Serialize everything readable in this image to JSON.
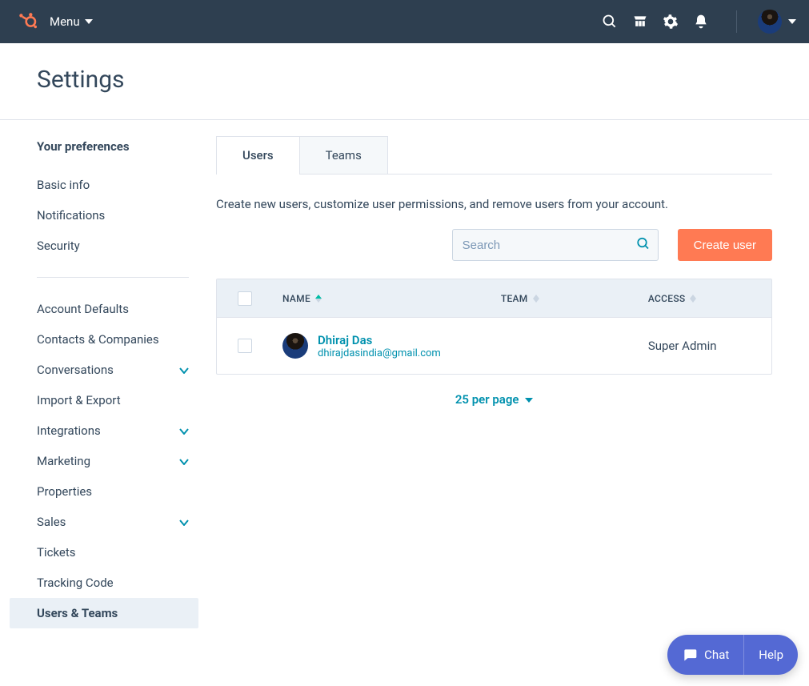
{
  "topnav": {
    "menu_label": "Menu"
  },
  "page": {
    "title": "Settings"
  },
  "sidebar": {
    "section_title": "Your preferences",
    "items_a": [
      {
        "label": "Basic info"
      },
      {
        "label": "Notifications"
      },
      {
        "label": "Security"
      }
    ],
    "items_b": [
      {
        "label": "Account Defaults",
        "expandable": false
      },
      {
        "label": "Contacts & Companies",
        "expandable": false
      },
      {
        "label": "Conversations",
        "expandable": true
      },
      {
        "label": "Import & Export",
        "expandable": false
      },
      {
        "label": "Integrations",
        "expandable": true
      },
      {
        "label": "Marketing",
        "expandable": true
      },
      {
        "label": "Properties",
        "expandable": false
      },
      {
        "label": "Sales",
        "expandable": true
      },
      {
        "label": "Tickets",
        "expandable": false
      },
      {
        "label": "Tracking Code",
        "expandable": false
      },
      {
        "label": "Users & Teams",
        "expandable": false,
        "active": true
      }
    ]
  },
  "tabs": [
    {
      "label": "Users",
      "active": true
    },
    {
      "label": "Teams",
      "active": false
    }
  ],
  "subtext": "Create new users, customize user permissions, and remove users from your account.",
  "toolbar": {
    "search_placeholder": "Search",
    "create_label": "Create user"
  },
  "table": {
    "columns": {
      "name": "NAME",
      "team": "TEAM",
      "access": "ACCESS"
    },
    "rows": [
      {
        "name": "Dhiraj Das",
        "email": "dhirajdasindia@gmail.com",
        "team": "",
        "access": "Super Admin"
      }
    ]
  },
  "pager": {
    "label": "25 per page"
  },
  "floating": {
    "chat_label": "Chat",
    "help_label": "Help"
  }
}
